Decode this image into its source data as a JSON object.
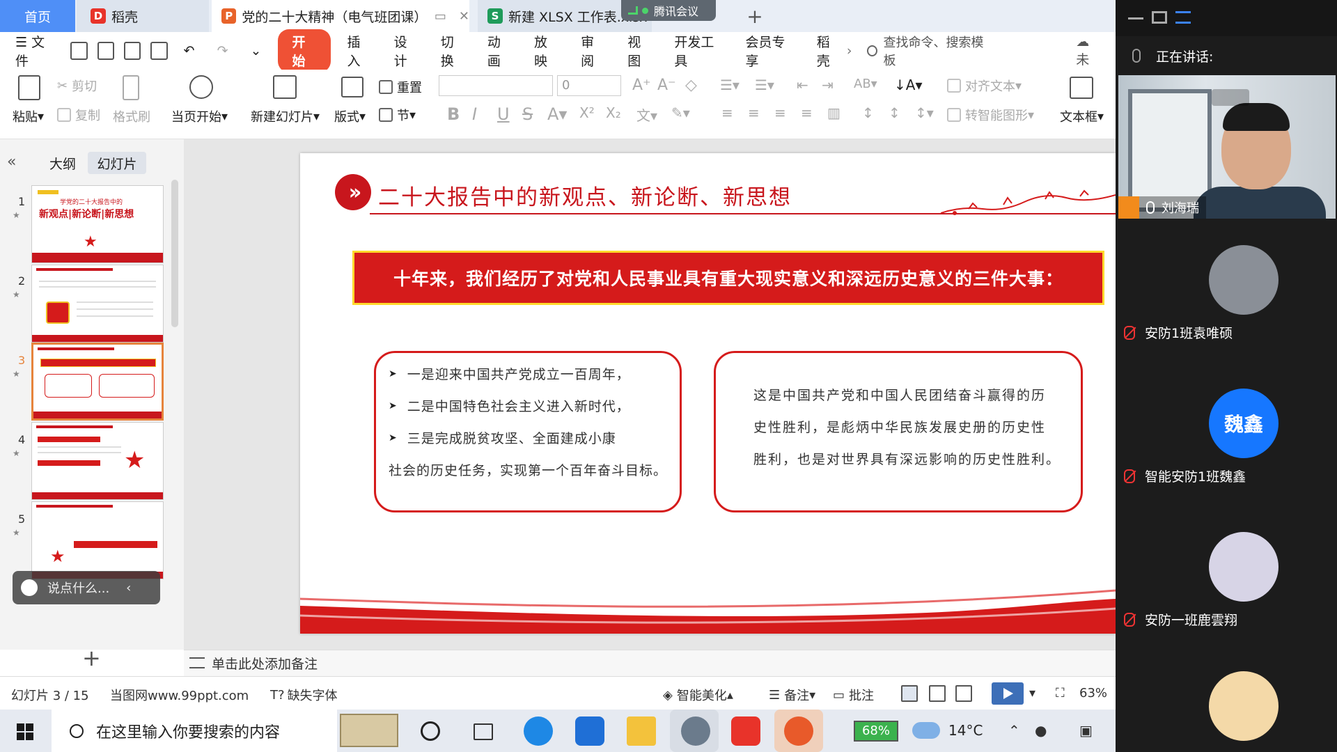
{
  "tabs": {
    "home": "首页",
    "daoke": "稻壳",
    "ppt": "党的二十大精神（电气班团课）",
    "xlsx": "新建 XLSX 工作表.xlsx",
    "plus": "+"
  },
  "tencent": {
    "label": "腾讯会议"
  },
  "menu": {
    "file": "文件",
    "items": [
      "开始",
      "插入",
      "设计",
      "切换",
      "动画",
      "放映",
      "审阅",
      "视图",
      "开发工具",
      "会员专享",
      "稻壳"
    ],
    "more": "›",
    "search": "查找命令、搜索模板",
    "cloud": "未"
  },
  "ribbon": {
    "paste": "粘贴",
    "cut": "剪切",
    "copy": "复制",
    "format_painter": "格式刷",
    "start_from_current": "当页开始",
    "new_slide": "新建幻灯片",
    "layout": "版式",
    "reset": "重置",
    "section": "节",
    "font_size": "0",
    "align_text": "对齐文本",
    "smart_shape": "转智能图形",
    "textbox": "文本框"
  },
  "left_panel": {
    "collapse": "«",
    "tab_outline": "大纲",
    "tab_slides": "幻灯片",
    "thumb1_title1": "学党的二十大报告中的",
    "thumb1_title2": "新观点|新论断|新思想",
    "thumb_numbers": [
      "1",
      "2",
      "3",
      "4",
      "5"
    ],
    "star": "★",
    "comment_placeholder": "说点什么...",
    "add_slide": "+"
  },
  "slide": {
    "title": "二十大报告中的新观点、新论断、新思想",
    "banner": "十年来，我们经历了对党和人民事业具有重大现实意义和深远历史意义的三件大事：",
    "left_items": [
      "一是迎来中国共产党成立一百周年，",
      "二是中国特色社会主义进入新时代，",
      "三是完成脱贫攻坚、全面建成小康"
    ],
    "left_continuation": "社会的历史任务，实现第一个百年奋斗目标。",
    "right_lines": [
      "这是中国共产党和中国人民团结奋斗赢得的历",
      "史性胜利，是彪炳中华民族发展史册的历史性",
      "胜利，也是对世界具有深远影响的历史性胜利。"
    ]
  },
  "notes": {
    "placeholder": "单击此处添加备注"
  },
  "status": {
    "slide_counter": "幻灯片 3 / 15",
    "source": "当图网www.99ppt.com",
    "missing_font": "缺失字体",
    "beautify": "智能美化",
    "notes": "备注",
    "comments": "批注",
    "zoom": "63%"
  },
  "taskbar": {
    "search_placeholder": "在这里输入你要搜索的内容",
    "battery": "68%",
    "temperature": "14°C"
  },
  "meeting": {
    "speaking_label": "正在讲话:",
    "active_speaker": "刘海瑞",
    "participants": [
      {
        "name": "安防1班袁唯硕"
      },
      {
        "name": "智能安防1班魏鑫",
        "avatar_text": "魏鑫"
      },
      {
        "name": "安防一班鹿雲翔"
      }
    ]
  },
  "colors": {
    "accent_red": "#c8161d",
    "banner_border": "#ffd92c",
    "tab_blue": "#4f8ff7",
    "ribbon_active": "#ef5135",
    "avatar_blue": "#1677ff"
  }
}
